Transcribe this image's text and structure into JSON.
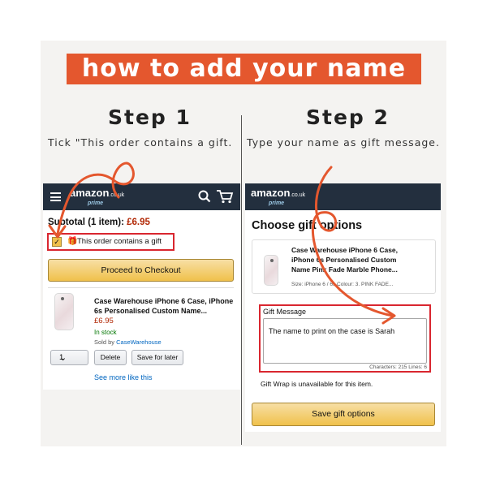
{
  "banner": {
    "title": "how to add your name"
  },
  "step1": {
    "title": "Step 1",
    "instruction": "Tick \"This order contains a gift."
  },
  "step2": {
    "title": "Step 2",
    "instruction": "Type your name as gift message."
  },
  "left_screen": {
    "header": {
      "logo_text": "amazon",
      "logo_tld": ".co.uk",
      "logo_sub": "prime",
      "icons": [
        "menu-icon",
        "search-icon",
        "cart-icon"
      ]
    },
    "subtotal_label": "Subtotal (1 item):",
    "subtotal_price": "£6.95",
    "gift_checkbox": {
      "checked": true,
      "label": "This order contains a gift"
    },
    "checkout_button": "Proceed to Checkout",
    "item": {
      "title_line1": "Case Warehouse iPhone 6 Case, iPhone",
      "title_line2": "6s Personalised Custom Name...",
      "price": "£6.95",
      "stock": "In stock",
      "sold_by_label": "Sold by",
      "seller": "CaseWarehouse",
      "quantity": "1",
      "delete_button": "Delete",
      "save_for_later_button": "Save for later",
      "see_more_link": "See more like this"
    }
  },
  "right_screen": {
    "header": {
      "logo_text": "amazon",
      "logo_tld": ".co.uk",
      "logo_sub": "prime"
    },
    "page_title": "Choose gift options",
    "item": {
      "title_line1": "Case Warehouse iPhone 6 Case,",
      "title_line2": "iPhone 6s Personalised Custom",
      "title_line3": "Name Pink Fade Marble Phone...",
      "details": "Size: iPhone 6 / 6s,Colour: 3. PINK FADE..."
    },
    "gift_message": {
      "label": "Gift Message",
      "value": "The name to print on the case is Sarah",
      "counter": "Characters: 215 Lines: 6"
    },
    "gift_wrap_note": "Gift Wrap is unavailable for this item.",
    "save_button": "Save gift options"
  },
  "colors": {
    "banner": "#e4572e",
    "annotation_red": "#d9262f",
    "amazon_header": "#232f3e",
    "button_yellow": "#f0c14b",
    "price_red": "#b12704",
    "stock_green": "#007600"
  }
}
